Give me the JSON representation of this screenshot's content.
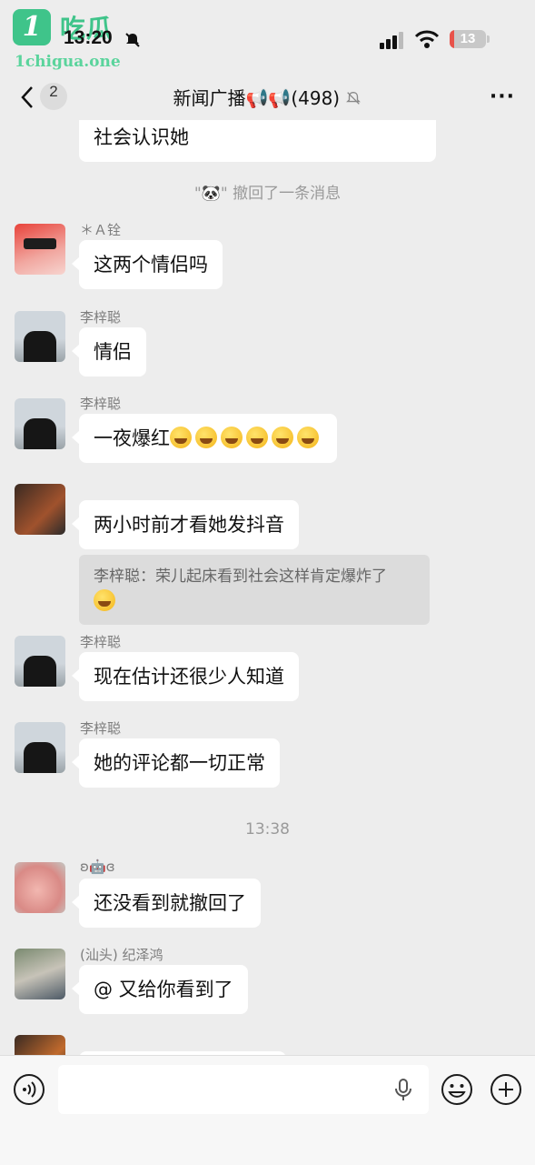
{
  "status": {
    "watermark_brand": "吃瓜",
    "watermark_site": "1chigua.one",
    "time": "13:20",
    "battery": "13"
  },
  "header": {
    "unread_count": "2",
    "title": "新闻广播📢📢(498)",
    "more": "···"
  },
  "messages": {
    "prev_text": "社会认识她",
    "recall_notice": "\"🐼\" 撤回了一条消息",
    "m1": {
      "sender": "＊Ａ铨",
      "text": "这两个情侣吗"
    },
    "m2": {
      "sender": "李梓聪",
      "text": "情侣"
    },
    "m3": {
      "sender": "李梓聪",
      "text": "一夜爆红"
    },
    "m4": {
      "text": "两小时前才看她发抖音",
      "quote": "李梓聪：荣儿起床看到社会这样肯定爆炸了"
    },
    "m5": {
      "sender": "李梓聪",
      "text": "现在估计还很少人知道"
    },
    "m6": {
      "sender": "李梓聪",
      "text": "她的评论都一切正常"
    },
    "time_divider": "13:38",
    "m7": {
      "sender": "ʚ🤖ɞ",
      "text": "还没看到就撤回了"
    },
    "m8": {
      "sender": "(汕头) 纪泽鸿",
      "text": "@ 又给你看到了"
    }
  },
  "colors": {
    "background": "#ededed",
    "bubble": "#ffffff",
    "watermark": "#3fc48a"
  }
}
